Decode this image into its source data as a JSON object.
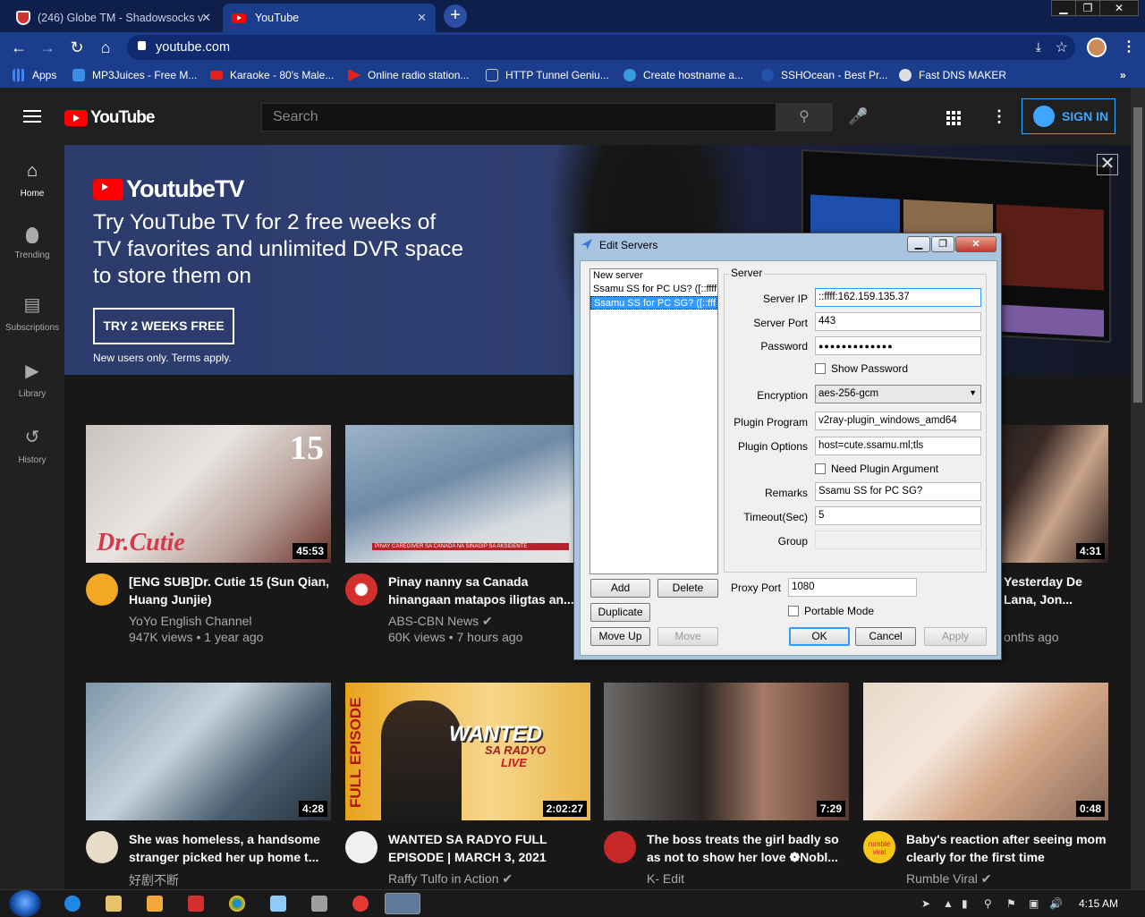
{
  "browser": {
    "tabs": [
      {
        "title": "(246) Globe TM - Shadowsocks v",
        "active": false
      },
      {
        "title": "YouTube",
        "active": true
      }
    ],
    "url": "youtube.com",
    "bookmarks": [
      {
        "label": "Apps",
        "color": "#4285f4"
      },
      {
        "label": "MP3Juices - Free M...",
        "color": "#3a8ee6"
      },
      {
        "label": "Karaoke - 80's Male...",
        "color": "#e62117"
      },
      {
        "label": "Online radio station...",
        "color": "#e62117"
      },
      {
        "label": "HTTP Tunnel Geniu...",
        "color": "#cccccc"
      },
      {
        "label": "Create hostname a...",
        "color": "#3a9bdc"
      },
      {
        "label": "SSHOcean - Best Pr...",
        "color": "#2255aa"
      },
      {
        "label": "Fast DNS MAKER",
        "color": "#dddddd"
      }
    ],
    "more_bookmarks": "»"
  },
  "youtube": {
    "logo": "YouTube",
    "search_placeholder": "Search",
    "sign_in": "SIGN IN",
    "guide": [
      {
        "label": "Home",
        "icon": "home-icon",
        "glyph": "⌂",
        "active": true
      },
      {
        "label": "Trending",
        "icon": "flame-icon",
        "glyph": "🔥",
        "active": false
      },
      {
        "label": "Subscriptions",
        "icon": "subscriptions-icon",
        "glyph": "▤",
        "active": false
      },
      {
        "label": "Library",
        "icon": "library-icon",
        "glyph": "▶",
        "active": false
      },
      {
        "label": "History",
        "icon": "history-icon",
        "glyph": "↺",
        "active": false
      }
    ],
    "banner": {
      "logo": "YoutubeTV",
      "title": "Try YouTube TV for 2 free weeks of TV favorites and unlimited DVR space to store them on",
      "cta": "TRY 2 WEEKS FREE",
      "terms": "New users only. Terms apply.",
      "close": "✕"
    },
    "videos": [
      {
        "title": "[ENG SUB]Dr. Cutie 15 (Sun Qian, Huang Junjie)",
        "channel": "YoYo English Channel",
        "meta": "947K views • 1 year ago",
        "duration": "45:53",
        "verified": false
      },
      {
        "title": "Pinay nanny sa Canada hinangaan matapos iligtas an...",
        "channel": "ABS-CBN News",
        "meta": "60K views • 7 hours ago",
        "duration": "",
        "verified": true
      },
      {
        "title": "Yesterday De Lana, Jon...",
        "channel": "",
        "meta": "onths ago",
        "duration": "4:31",
        "verified": false
      },
      {
        "title": "She was homeless, a handsome stranger picked her up home t...",
        "channel": "好剧不断",
        "meta": "",
        "duration": "4:28",
        "verified": false
      },
      {
        "title": "WANTED SA RADYO FULL EPISODE | MARCH 3, 2021",
        "channel": "Raffy Tulfo in Action",
        "meta": "",
        "duration": "2:02:27",
        "verified": true
      },
      {
        "title": "The boss treats the girl badly so as not to show her love ❁Nobl...",
        "channel": "K- Edit",
        "meta": "",
        "duration": "7:29",
        "verified": false
      },
      {
        "title": "Baby's reaction after seeing mom clearly for the first time",
        "channel": "Rumble Viral",
        "meta": "",
        "duration": "0:48",
        "verified": true
      }
    ],
    "thumb_text": {
      "v1_big": "15",
      "v1_script": "Dr.Cutie",
      "v2_caption": "PINAY CAREGIVER SA CANADA NA SINAGIP SA AKSIDENTE",
      "v5_side": "FULL EPISODE",
      "v5_wanted": "WANTED",
      "v5_radyo": "SA RADYO",
      "v5_live": "LIVE",
      "rumble": "rumble viral"
    }
  },
  "dialog": {
    "title": "Edit Servers",
    "servers": [
      {
        "label": "New server",
        "selected": false
      },
      {
        "label": "Ssamu SS for PC US? ([::ffff",
        "selected": false
      },
      {
        "label": "Ssamu SS for PC SG? ([::fff",
        "selected": true
      }
    ],
    "group_label": "Server",
    "fields": {
      "server_ip": {
        "label": "Server IP",
        "value": "::ffff:162.159.135.37"
      },
      "server_port": {
        "label": "Server Port",
        "value": "443"
      },
      "password": {
        "label": "Password",
        "value": "●●●●●●●●●●●●●"
      },
      "show_password": "Show Password",
      "encryption": {
        "label": "Encryption",
        "value": "aes-256-gcm"
      },
      "plugin_program": {
        "label": "Plugin Program",
        "value": "v2ray-plugin_windows_amd64"
      },
      "plugin_options": {
        "label": "Plugin Options",
        "value": "host=cute.ssamu.ml;tls"
      },
      "need_plugin_argument": "Need Plugin Argument",
      "remarks": {
        "label": "Remarks",
        "value": "Ssamu SS for PC SG?"
      },
      "timeout": {
        "label": "Timeout(Sec)",
        "value": "5"
      },
      "group": {
        "label": "Group",
        "value": ""
      }
    },
    "buttons": {
      "add": "Add",
      "delete": "Delete",
      "duplicate": "Duplicate",
      "move_up": "Move Up",
      "move": "Move",
      "ok": "OK",
      "cancel": "Cancel",
      "apply": "Apply"
    },
    "proxy_port": {
      "label": "Proxy Port",
      "value": "1080"
    },
    "portable_mode": "Portable Mode"
  },
  "taskbar": {
    "time": "4:15 AM"
  }
}
